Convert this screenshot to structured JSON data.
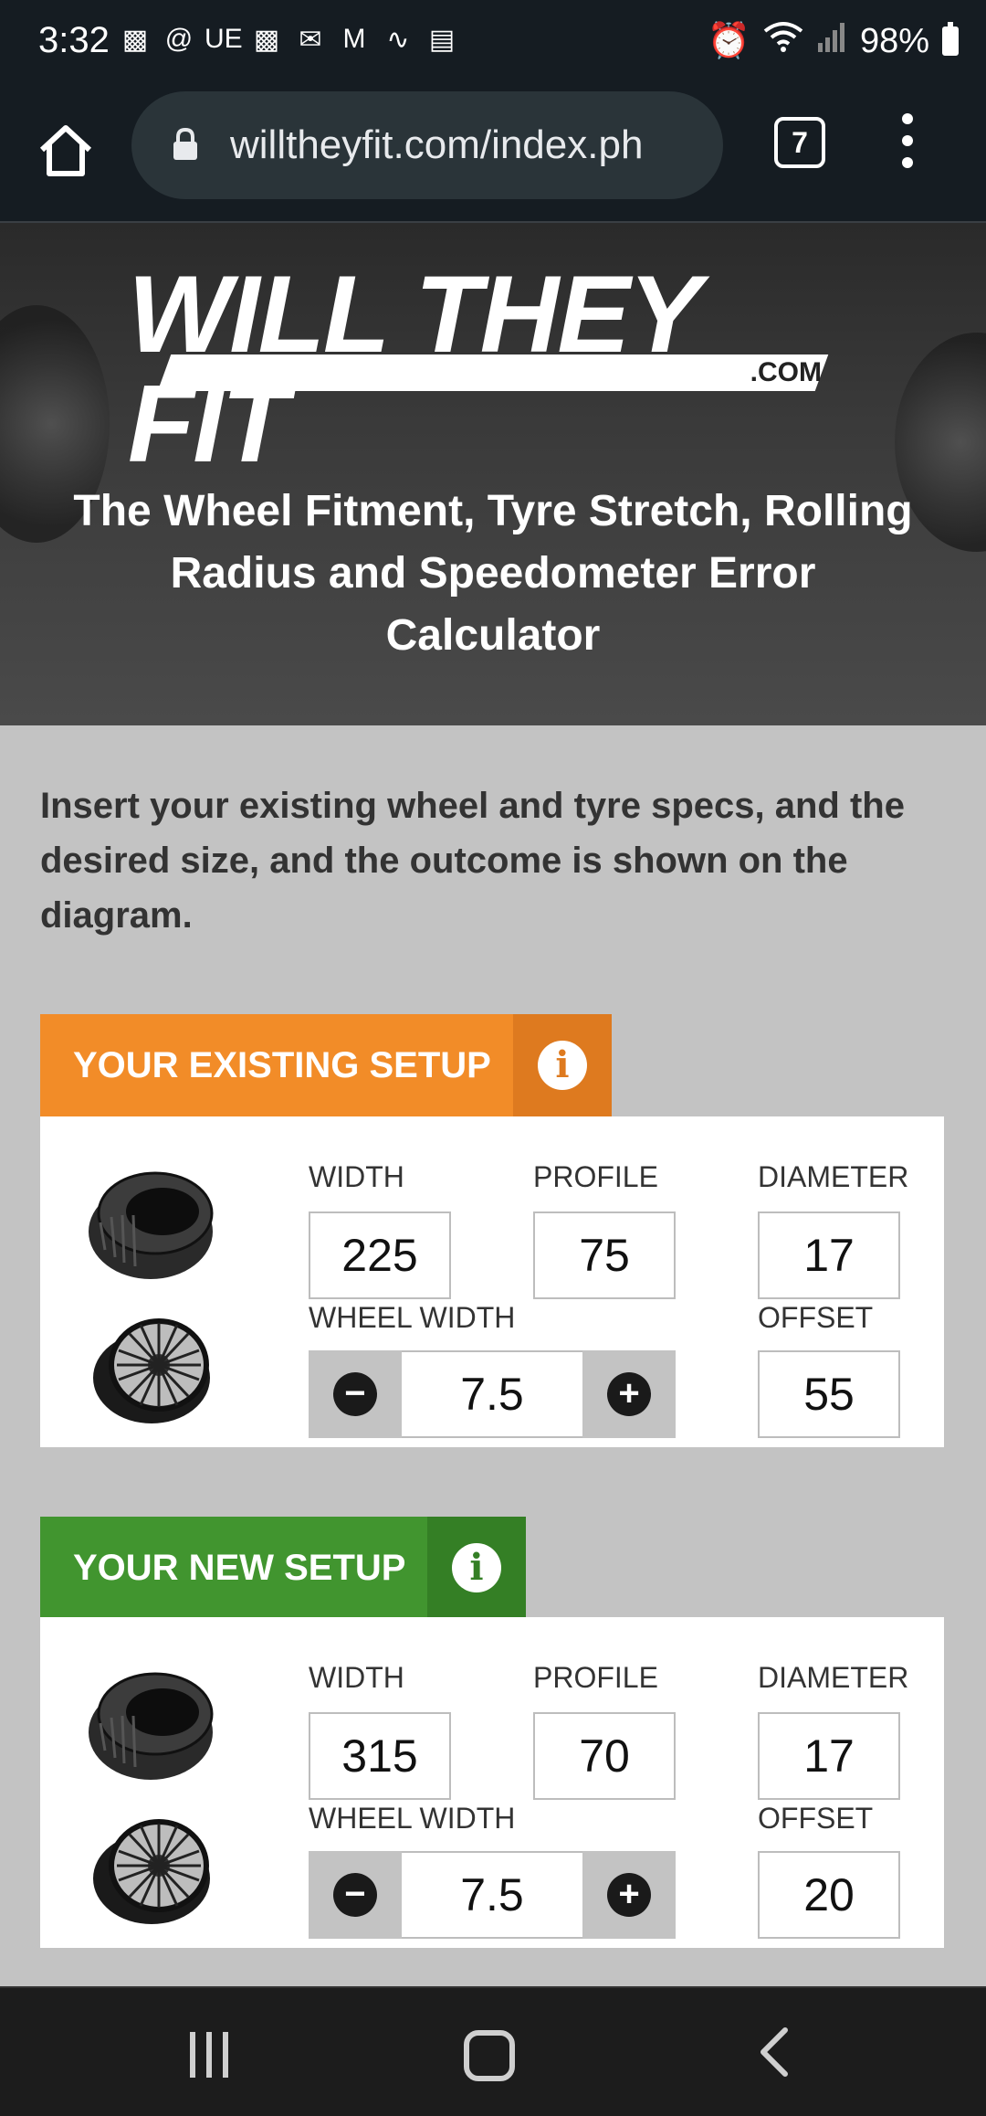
{
  "status_bar": {
    "time": "3:32",
    "notification_icons": [
      "teams-icon",
      "threads-icon",
      "ue-text",
      "teams-icon",
      "outlook-icon",
      "gmail-icon",
      "wave-icon",
      "calendar-icon"
    ],
    "ue_label": "UE",
    "battery": "98%"
  },
  "browser": {
    "url": "willtheyfit.com/index.ph",
    "tab_count": "7"
  },
  "hero": {
    "logo_text": "WILL THEY FIT",
    "logo_suffix": ".COM",
    "title": "The Wheel Fitment, Tyre Stretch, Rolling Radius and Speedometer Error Calculator"
  },
  "intro": "Insert your existing wheel and tyre specs, and the desired size, and the outcome is shown on the diagram.",
  "existing": {
    "header": "YOUR EXISTING SETUP",
    "info_glyph": "i",
    "width_label": "WIDTH",
    "profile_label": "PROFILE",
    "diameter_label": "DIAMETER",
    "wheel_width_label": "WHEEL WIDTH",
    "offset_label": "OFFSET",
    "width": "225",
    "profile": "75",
    "diameter": "17",
    "wheel_width": "7.5",
    "offset": "55"
  },
  "new": {
    "header": "YOUR NEW SETUP",
    "info_glyph": "i",
    "width_label": "WIDTH",
    "profile_label": "PROFILE",
    "diameter_label": "DIAMETER",
    "wheel_width_label": "WHEEL WIDTH",
    "offset_label": "OFFSET",
    "width": "315",
    "profile": "70",
    "diameter": "17",
    "wheel_width": "7.5",
    "offset": "20"
  },
  "stepper": {
    "minus": "−",
    "plus": "+"
  },
  "colors": {
    "existing_accent": "#f28c28",
    "new_accent": "#41952f",
    "page_background": "#c3c3c3"
  }
}
